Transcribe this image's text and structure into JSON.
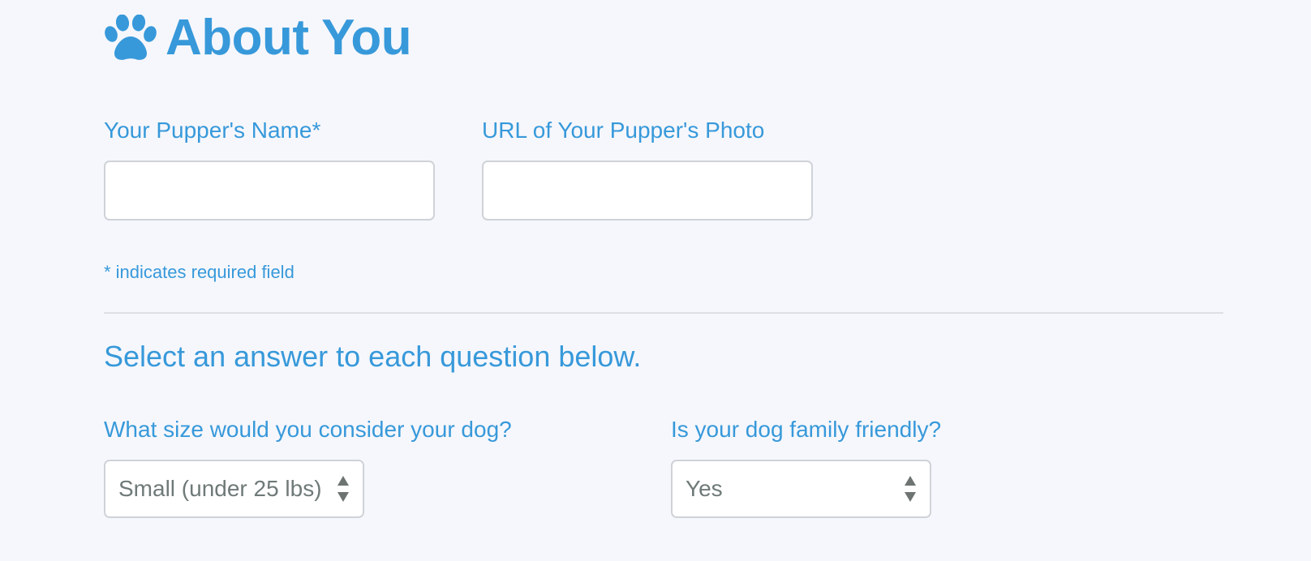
{
  "header": {
    "title": "About You",
    "icon": "paw-icon"
  },
  "fields": {
    "pupper_name": {
      "label": "Your Pupper's Name*",
      "value": "",
      "placeholder": ""
    },
    "pupper_photo": {
      "label": "URL of Your Pupper's Photo",
      "value": "",
      "placeholder": ""
    }
  },
  "required_note": "* indicates required field",
  "questions_heading": "Select an answer to each question below.",
  "questions": {
    "size": {
      "label": "What size would you consider your dog?",
      "selected": "Small (under 25 lbs)"
    },
    "family_friendly": {
      "label": "Is your dog family friendly?",
      "selected": "Yes"
    }
  },
  "colors": {
    "accent": "#3799da",
    "background": "#f6f7fc",
    "input_border": "#cfd3d8",
    "select_text": "#6f7a78"
  }
}
